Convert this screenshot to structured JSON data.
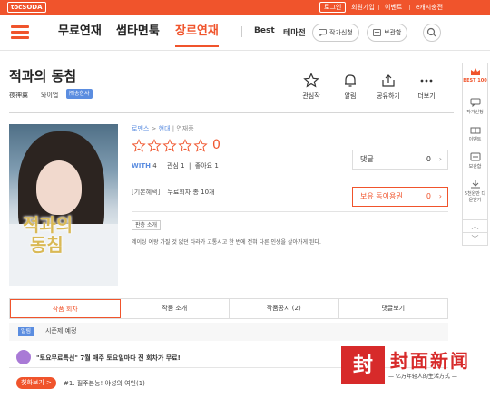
{
  "topbar": {
    "logo": "tocSODA",
    "login": "로그인",
    "signup": "회원가입",
    "event": "이벤트",
    "charge": "e캐시충전"
  },
  "nav": {
    "tabs": [
      "무료연재",
      "썸타면툭",
      "장르연재"
    ],
    "active_tab": "장르연재",
    "best": "Best",
    "theme": "테마전",
    "request": "작가신청",
    "library": "보관함"
  },
  "novel": {
    "title": "적과의 동침",
    "author": "夜神翼",
    "author_kr": "와이업",
    "badge": "㈜송한사"
  },
  "actions": [
    {
      "icon": "star-icon",
      "label": "관심작"
    },
    {
      "icon": "bell-icon",
      "label": "알림"
    },
    {
      "icon": "share-icon",
      "label": "공유하기"
    },
    {
      "icon": "more-icon",
      "label": "더보기"
    }
  ],
  "cover": {
    "title_line1": "적과의",
    "title_line2": "동침"
  },
  "info": {
    "genre": "로맨스",
    "subgenre": "현대",
    "status": "연재중",
    "rating": "0",
    "with_label": "WITH",
    "with_count": "4",
    "interest_label": "관심",
    "interest_count": "1",
    "like_label": "좋아요",
    "like_count": "1",
    "gift_tag": "[기본혜택]",
    "gift_text": "무료회차 총 10개",
    "intro_tag": "판층 소개",
    "intro": "레이싱 여왕 가질 것 없던 타라가 고통시고 한 번에 전혀 다른 인생을 살아가게 된다."
  },
  "boxes": {
    "comment_label": "댓글",
    "comment_count": "0",
    "coupon_label": "보유 독이용권",
    "coupon_count": "0"
  },
  "tabs": [
    "작품 회차",
    "작품 소개",
    "작품공지 (2)",
    "댓글보기"
  ],
  "notice": {
    "label": "알림",
    "text": "시즌제 예정"
  },
  "promo": {
    "text": "\"토요무료특선\" 7월 매주 토요일마다 전 회차가 무료!"
  },
  "first_view": {
    "label": "첫화보기 >",
    "episode": "#1. 질주본능! 야성의 여인(1)"
  },
  "sidebar": {
    "best": "BEST 100",
    "items": [
      "작가신청",
      "이벤트",
      "보관함",
      "5천원만 다운받기"
    ]
  },
  "watermark": {
    "square": "封",
    "title": "封面新闻",
    "slogan": "— 亿万年轻人的生活方式 —"
  },
  "colors": {
    "accent": "#f0542c",
    "blue": "#5b8de0"
  }
}
